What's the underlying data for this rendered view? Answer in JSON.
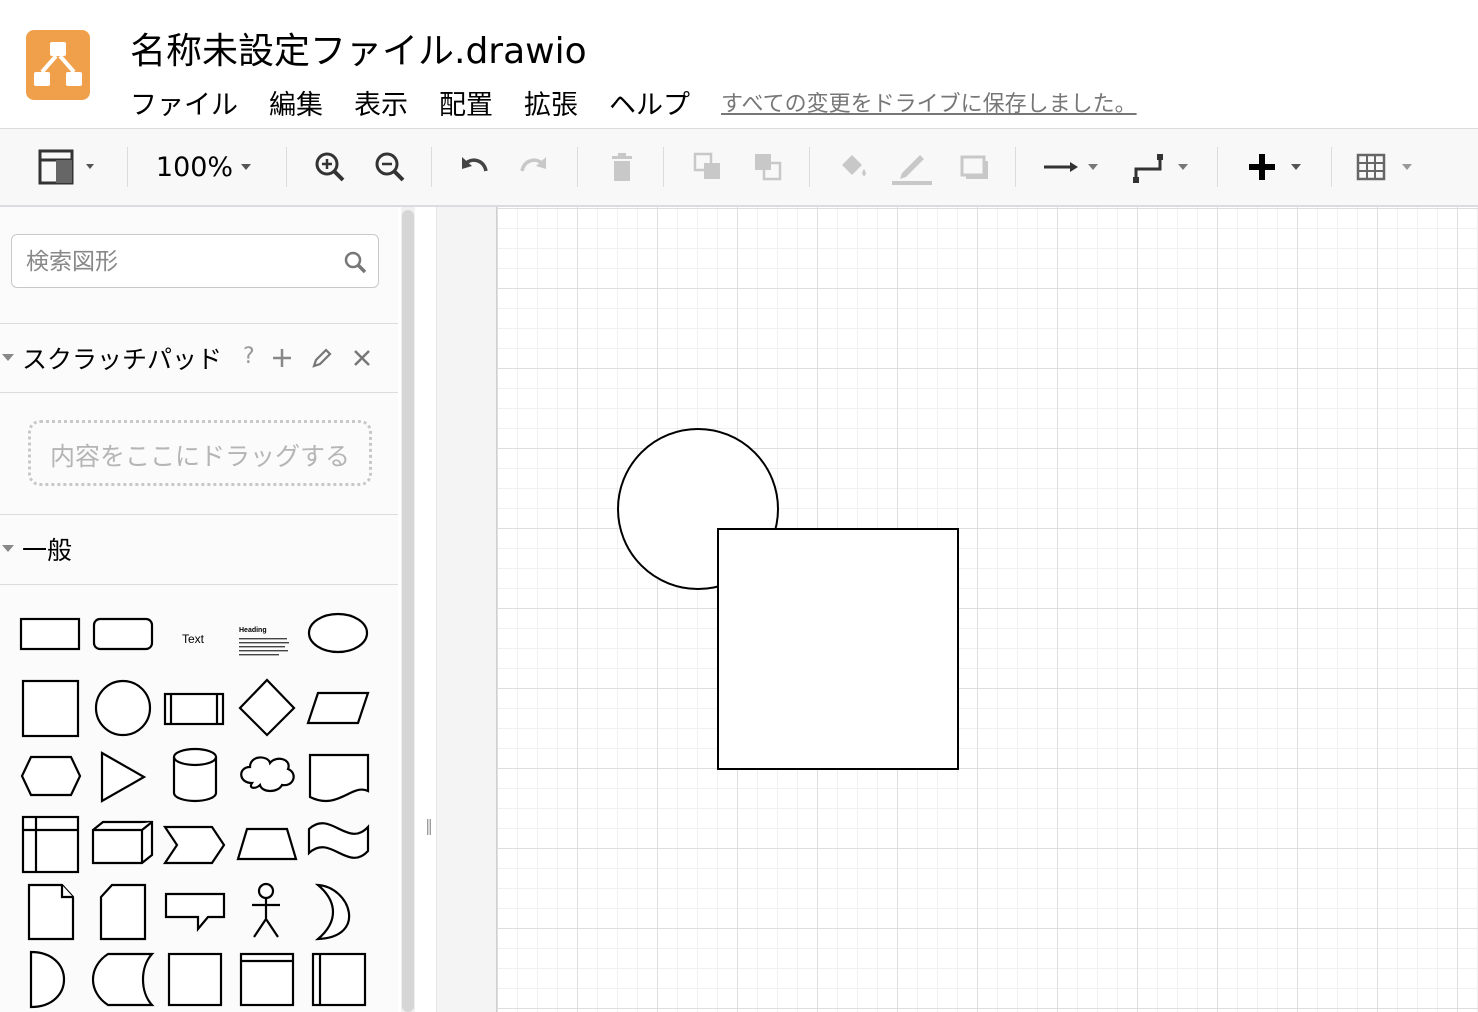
{
  "header": {
    "title": "名称未設定ファイル.drawio",
    "menu": [
      "ファイル",
      "編集",
      "表示",
      "配置",
      "拡張",
      "ヘルプ"
    ],
    "save_status": "すべての変更をドライブに保存しました。"
  },
  "toolbar": {
    "zoom": "100%",
    "icons": [
      "format-panel-icon",
      "zoom-in-icon",
      "zoom-out-icon",
      "undo-icon",
      "redo-icon",
      "delete-icon",
      "to-front-icon",
      "to-back-icon",
      "fill-color-icon",
      "line-color-icon",
      "shadow-icon",
      "connection-icon",
      "waypoints-icon",
      "insert-icon",
      "table-icon"
    ]
  },
  "sidebar": {
    "search_placeholder": "検索図形",
    "scratchpad": {
      "label": "スクラッチパッド",
      "help": "?",
      "drop_hint": "内容をここにドラッグする"
    },
    "general": {
      "label": "一般",
      "text_shape_label": "Text",
      "heading_shape_label": "Heading",
      "heading_shape_body": "Lorem ipsum dolor sit amet, consectetur adipisicing elit, sed do eiusmod tempor incididunt ut labore et dolore magna aliqua."
    }
  },
  "canvas": {
    "shapes": [
      "ellipse",
      "rectangle"
    ]
  }
}
